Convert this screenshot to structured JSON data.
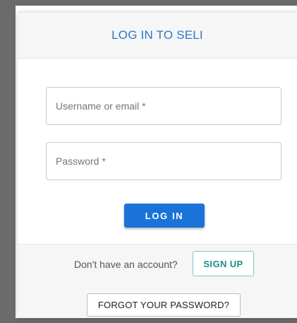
{
  "dialog": {
    "title": "LOG IN TO SELI"
  },
  "form": {
    "username_placeholder": "Username or email *",
    "username_value": "",
    "password_placeholder": "Password *",
    "password_value": "",
    "login_label": "LOG IN"
  },
  "signup": {
    "prompt": "Don't have an account?",
    "button_label": "SIGN UP"
  },
  "forgot": {
    "button_label": "FORGOT YOUR PASSWORD?"
  },
  "colors": {
    "accent": "#1a73d9",
    "title": "#2b78c6",
    "signup": "#1e8c88"
  }
}
